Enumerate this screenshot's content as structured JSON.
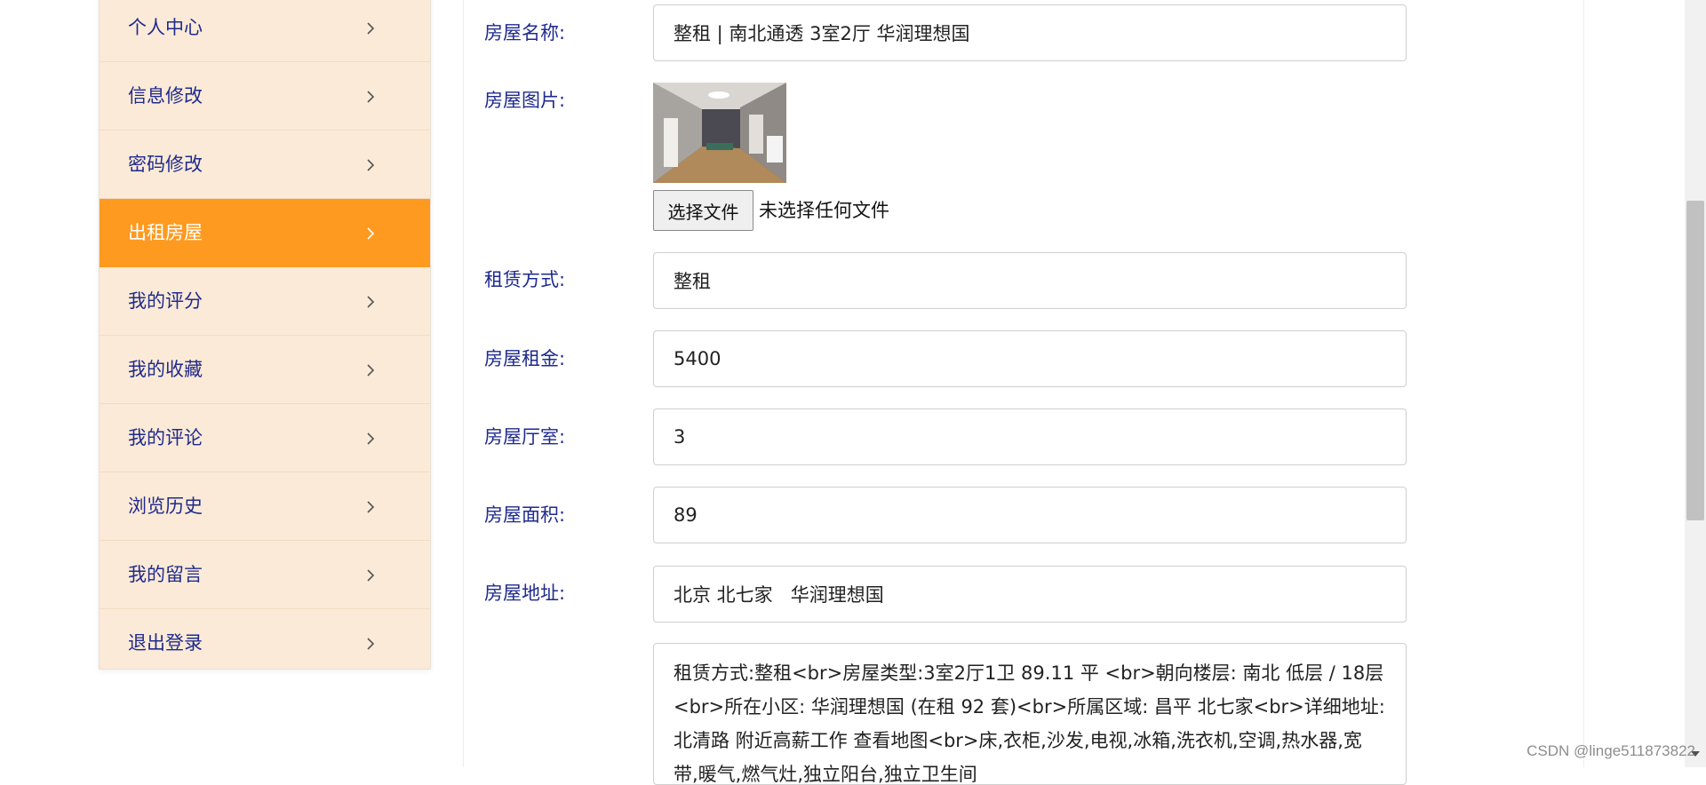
{
  "sidebar": {
    "items": [
      {
        "label": "个人中心",
        "active": false
      },
      {
        "label": "信息修改",
        "active": false
      },
      {
        "label": "密码修改",
        "active": false
      },
      {
        "label": "出租房屋",
        "active": true
      },
      {
        "label": "我的评分",
        "active": false
      },
      {
        "label": "我的收藏",
        "active": false
      },
      {
        "label": "我的评论",
        "active": false
      },
      {
        "label": "浏览历史",
        "active": false
      },
      {
        "label": "我的留言",
        "active": false
      },
      {
        "label": "退出登录",
        "active": false
      }
    ],
    "chevron_icon": "chevron-right-icon",
    "active_color": "#ff9a20",
    "background_color": "#fbead7"
  },
  "form": {
    "name_label": "房屋名称:",
    "name_value": "整租 | 南北通透 3室2厅 华润理想国",
    "image_label": "房屋图片:",
    "file_button": "选择文件",
    "file_status": "未选择任何文件",
    "rent_type_label": "租赁方式:",
    "rent_type_value": "整租",
    "rent_label": "房屋租金:",
    "rent_value": "5400",
    "rooms_label": "房屋厅室:",
    "rooms_value": "3",
    "area_label": "房屋面积:",
    "area_value": "89",
    "address_label": "房屋地址:",
    "address_value": "北京 北七家   华润理想国",
    "description": "租赁方式:整租<br>房屋类型:3室2厅1卫  89.11 平  <br>朝向楼层:  南北  低层 / 18层<br>所在小区:  华润理想国 (在租 92 套)<br>所属区域:  昌平   北七家<br>详细地址:  北清路 附近高薪工作    查看地图<br>床,衣柜,沙发,电视,冰箱,洗衣机,空调,热水器,宽带,暖气,燃气灶,独立阳台,独立卫生间"
  },
  "watermark": "CSDN @linge511873822"
}
